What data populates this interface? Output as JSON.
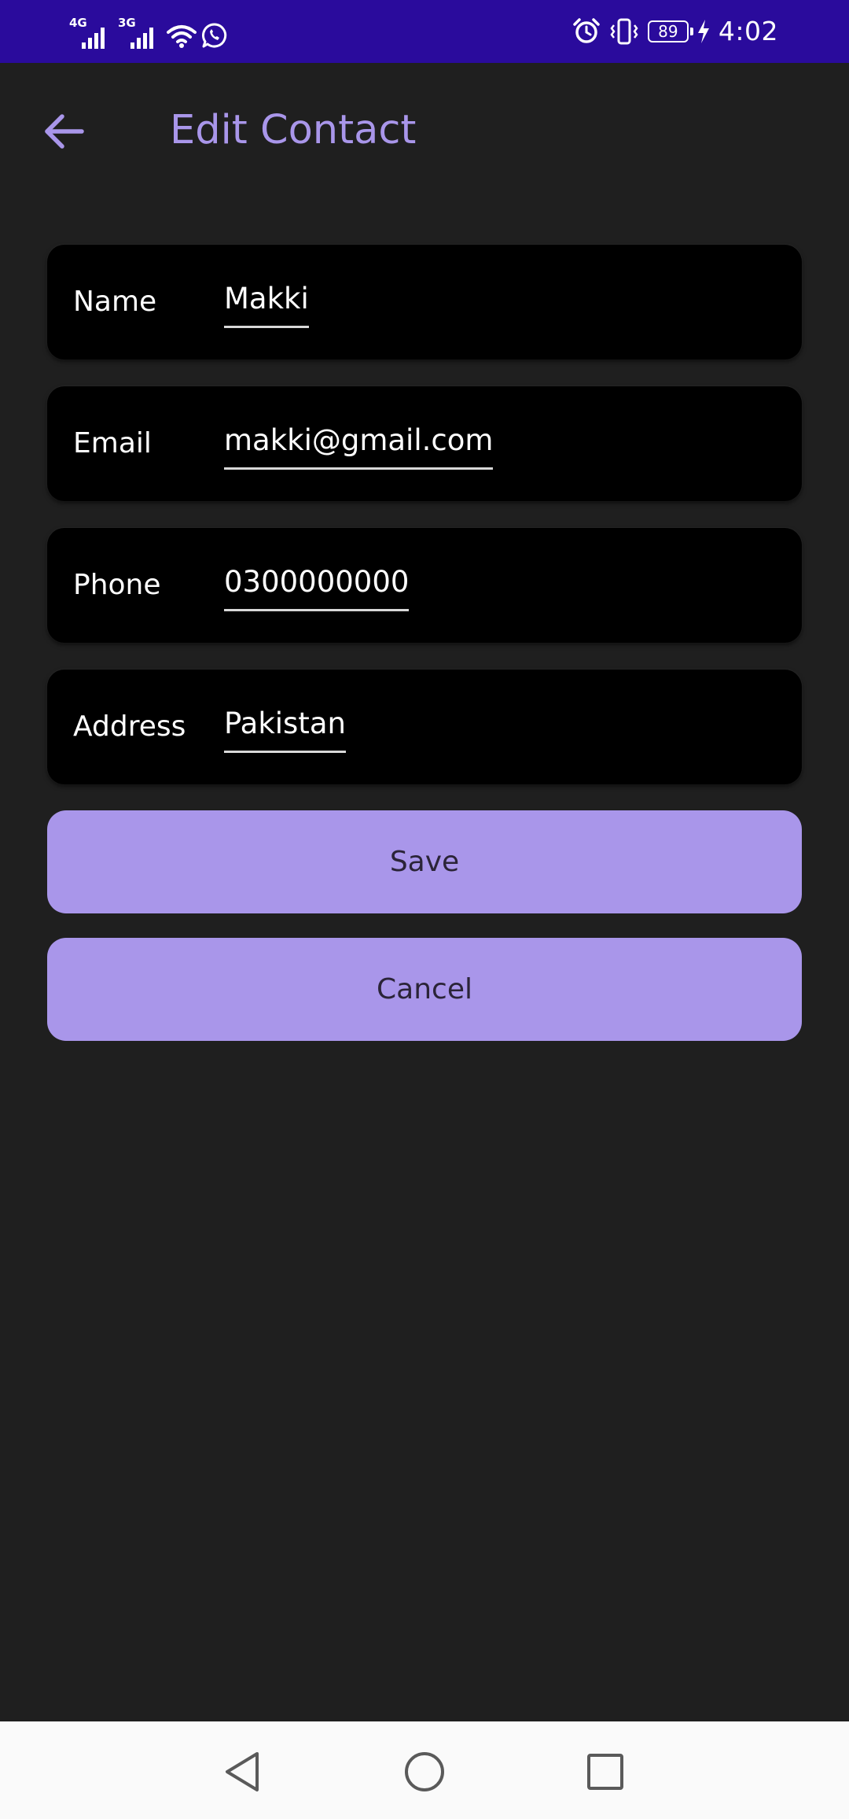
{
  "status_bar": {
    "network_1": "4G",
    "network_2": "3G",
    "battery_level": "89",
    "time": "4:02",
    "icons": [
      "signal-icon",
      "wifi-icon",
      "whatsapp-icon",
      "alarm-icon",
      "vibrate-icon",
      "battery-icon",
      "charging-icon"
    ]
  },
  "app_bar": {
    "title": "Edit Contact",
    "back_icon": "arrow-left-icon"
  },
  "form": {
    "fields": [
      {
        "label": "Name",
        "value": "Makki"
      },
      {
        "label": "Email",
        "value": "makki@gmail.com"
      },
      {
        "label": "Phone",
        "value": "0300000000"
      },
      {
        "label": "Address",
        "value": "Pakistan"
      }
    ]
  },
  "actions": {
    "save_label": "Save",
    "cancel_label": "Cancel"
  },
  "nav_bar": {
    "icons": [
      "back-triangle-icon",
      "home-circle-icon",
      "recents-square-icon"
    ]
  },
  "colors": {
    "status_bar": "#2a0b9c",
    "background": "#1f1f1f",
    "accent": "#a996ea",
    "card": "#000000"
  }
}
